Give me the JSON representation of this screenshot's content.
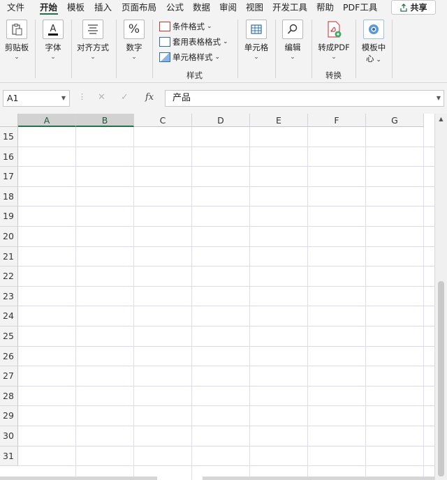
{
  "menu": {
    "items": [
      "文件",
      "开始",
      "模板",
      "插入",
      "页面布局",
      "公式",
      "数据",
      "审阅",
      "视图",
      "开发工具",
      "帮助",
      "PDF工具"
    ],
    "active": "开始",
    "share_label": "共享"
  },
  "ribbon": {
    "clipboard": "剪贴板",
    "font": "字体",
    "align": "对齐方式",
    "number": "数字",
    "cond_format": "条件格式",
    "table_format": "套用表格格式",
    "cell_style": "单元格样式",
    "styles_group": "样式",
    "cells": "单元格",
    "editing": "编辑",
    "to_pdf": "转成PDF",
    "convert_group": "转换",
    "template_center_1": "模板中",
    "template_center_2": "心",
    "font_glyph": "A",
    "number_glyph": "%"
  },
  "formula_bar": {
    "name_box": "A1",
    "cancel": "✕",
    "enter": "✓",
    "fx": "fx",
    "content": "产品"
  },
  "sheet": {
    "columns": [
      "A",
      "B",
      "C",
      "D",
      "E",
      "F",
      "G"
    ],
    "selected_columns": [
      "A",
      "B"
    ],
    "rows": [
      "15",
      "16",
      "17",
      "18",
      "19",
      "20",
      "21",
      "22",
      "23",
      "24",
      "25",
      "26",
      "27",
      "28",
      "29",
      "30",
      "31"
    ]
  },
  "colors": {
    "accent": "#217346",
    "gridline": "#d9d9ea"
  }
}
